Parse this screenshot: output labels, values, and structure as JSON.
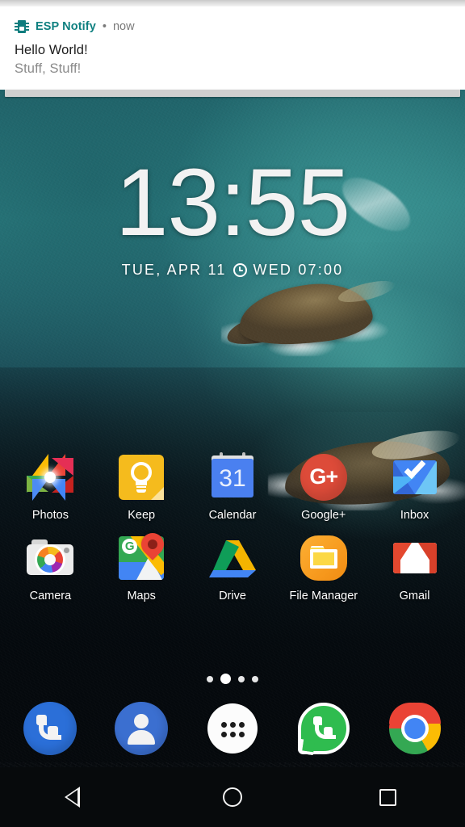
{
  "notification": {
    "app_name": "ESP Notify",
    "separator": "•",
    "time": "now",
    "title": "Hello World!",
    "body": "Stuff, Stuff!",
    "icon": "chip-icon",
    "accent_color": "#0f8080",
    "title_color": "#1b1b1b",
    "body_color": "#8a8a8a",
    "card_background": "#ffffff"
  },
  "clock_widget": {
    "time": "13:55",
    "date": "TUE, APR 11",
    "alarm_icon": "alarm-clock-icon",
    "alarm": "WED 07:00",
    "text_color": "#ffffff"
  },
  "app_grid": {
    "rows": [
      [
        {
          "label": "Photos",
          "icon": "google-photos-icon"
        },
        {
          "label": "Keep",
          "icon": "google-keep-icon"
        },
        {
          "label": "Calendar",
          "icon": "google-calendar-icon",
          "badge": "31"
        },
        {
          "label": "Google+",
          "icon": "google-plus-icon",
          "glyph": "G+"
        },
        {
          "label": "Inbox",
          "icon": "google-inbox-icon"
        }
      ],
      [
        {
          "label": "Camera",
          "icon": "google-camera-icon"
        },
        {
          "label": "Maps",
          "icon": "google-maps-icon",
          "glyph": "G"
        },
        {
          "label": "Drive",
          "icon": "google-drive-icon"
        },
        {
          "label": "File Manager",
          "icon": "file-manager-icon"
        },
        {
          "label": "Gmail",
          "icon": "gmail-icon"
        }
      ]
    ]
  },
  "page_indicator": {
    "count": 4,
    "active_index": 1
  },
  "dock": {
    "items": [
      {
        "label": "Phone",
        "icon": "phone-icon"
      },
      {
        "label": "Contacts",
        "icon": "contacts-icon"
      },
      {
        "label": "All Apps",
        "icon": "app-drawer-icon"
      },
      {
        "label": "WhatsApp",
        "icon": "whatsapp-icon"
      },
      {
        "label": "Chrome",
        "icon": "chrome-icon"
      }
    ]
  },
  "navbar": {
    "back": "Back",
    "home": "Home",
    "recents": "Recents",
    "back_icon": "back-triangle-icon",
    "home_icon": "home-circle-icon",
    "recents_icon": "recents-square-icon"
  },
  "wallpaper": {
    "description": "Aerial ocean with rocky islands",
    "primary_color": "#2b7d80",
    "dark_color": "#06090c"
  }
}
